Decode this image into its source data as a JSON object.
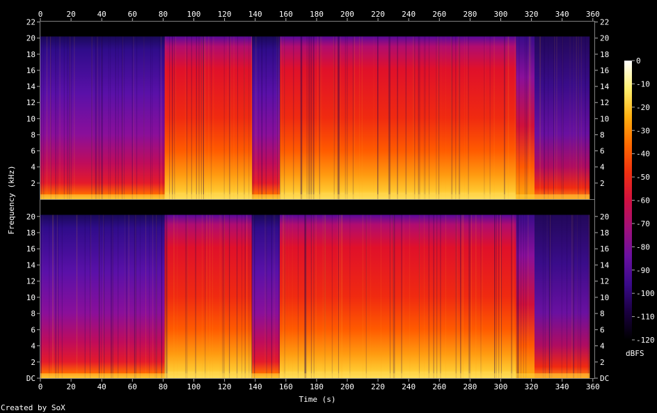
{
  "chart_data": {
    "type": "heatmap",
    "title": "",
    "xlabel": "Time (s)",
    "ylabel": "Frequency (kHz)",
    "footer": "Created by SoX",
    "x_ticks": [
      "0",
      "20",
      "40",
      "60",
      "80",
      "100",
      "120",
      "140",
      "160",
      "180",
      "200",
      "220",
      "240",
      "260",
      "280",
      "300",
      "320",
      "340",
      "360"
    ],
    "x_values": [
      0,
      20,
      40,
      60,
      80,
      100,
      120,
      140,
      160,
      180,
      200,
      220,
      240,
      260,
      280,
      300,
      320,
      340,
      360
    ],
    "xlim": [
      0,
      361
    ],
    "ylim": [
      0,
      22.05
    ],
    "y_ticks_top": [
      "2",
      "4",
      "6",
      "8",
      "10",
      "12",
      "14",
      "16",
      "18",
      "20",
      "22"
    ],
    "y_ticks_bottom": [
      "DC",
      "2",
      "4",
      "6",
      "8",
      "10",
      "12",
      "14",
      "16",
      "18",
      "20"
    ],
    "y_values_top": [
      2,
      4,
      6,
      8,
      10,
      12,
      14,
      16,
      18,
      20,
      22
    ],
    "y_values_bottom": [
      0,
      2,
      4,
      6,
      8,
      10,
      12,
      14,
      16,
      18,
      20
    ],
    "channels": [
      "left",
      "right"
    ],
    "colorbar": {
      "label": "dBFS",
      "ticks": [
        "0",
        "-10",
        "-20",
        "-30",
        "-40",
        "-50",
        "-60",
        "-70",
        "-80",
        "-90",
        "-100",
        "-110",
        "-120"
      ],
      "tick_values": [
        0,
        -10,
        -20,
        -30,
        -40,
        -50,
        -60,
        -70,
        -80,
        -90,
        -100,
        -110,
        -120
      ],
      "range": [
        -120,
        0
      ],
      "colors": [
        "#000000",
        "#1a0040",
        "#3a0a8a",
        "#6a10a0",
        "#a0107a",
        "#d01040",
        "#f03010",
        "#ff6a00",
        "#ffb010",
        "#fff070",
        "#ffffff"
      ]
    },
    "segments": [
      {
        "t0": 0,
        "t1": 81,
        "level": "low"
      },
      {
        "t0": 81,
        "t1": 138,
        "level": "high"
      },
      {
        "t0": 138,
        "t1": 156,
        "level": "low"
      },
      {
        "t0": 156,
        "t1": 310,
        "level": "high"
      },
      {
        "t0": 310,
        "t1": 322,
        "level": "mid"
      },
      {
        "t0": 322,
        "t1": 358,
        "level": "fade"
      }
    ],
    "cutoff_khz": 20.2
  }
}
